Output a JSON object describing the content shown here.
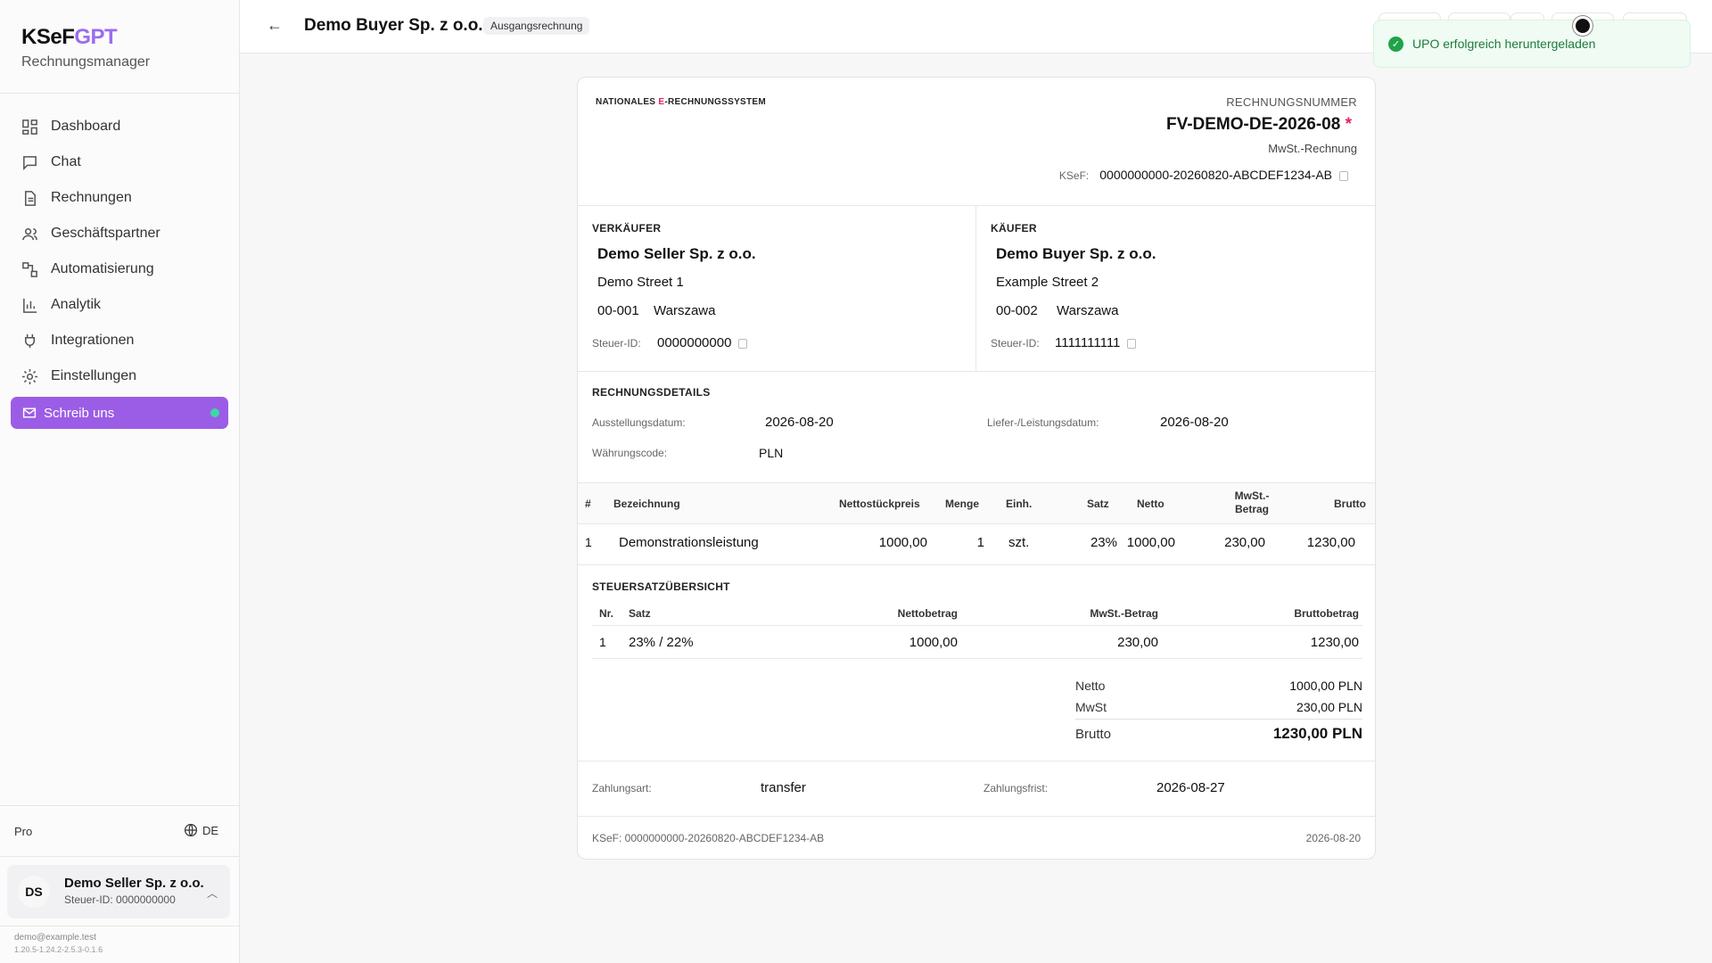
{
  "sidebar": {
    "brand_main": "KSeF",
    "brand_accent": "GPT",
    "brand_sub": "Rechnungsmanager",
    "nav": [
      {
        "label": "Dashboard",
        "icon": "dashboard-icon"
      },
      {
        "label": "Chat",
        "icon": "chat-icon"
      },
      {
        "label": "Rechnungen",
        "icon": "document-icon"
      },
      {
        "label": "Geschäftspartner",
        "icon": "users-icon"
      },
      {
        "label": "Automatisierung",
        "icon": "workflow-icon"
      },
      {
        "label": "Analytik",
        "icon": "bar-chart-icon"
      },
      {
        "label": "Integrationen",
        "icon": "plug-icon"
      },
      {
        "label": "Einstellungen",
        "icon": "gear-icon"
      }
    ],
    "write_us": "Schreib uns",
    "plan": "Pro",
    "language": "DE",
    "account": {
      "initials": "DS",
      "name": "Demo Seller Sp. z o.o.",
      "tax_id": "Steuer-ID: 0000000000"
    },
    "email": "demo@example.test",
    "version": "1.20.5-1.24.2-2.5.3-0.1.6"
  },
  "header": {
    "title": "Demo Buyer Sp. z o.o.",
    "badge": "Ausgangsrechnung"
  },
  "toast": {
    "message": "UPO erfolgreich heruntergeladen"
  },
  "invoice": {
    "system_name_pre": "NATIONALES ",
    "system_name_accent": "E",
    "system_name_post": "-RECHNUNGSSYSTEM",
    "number_label": "RECHNUNGSNUMMER",
    "number": "FV-DEMO-DE-2026-08",
    "required_mark": "*",
    "type": "MwSt.-Rechnung",
    "ksef_label": "KSeF:",
    "ksef_number": "0000000000-20260820-ABCDEF1234-AB",
    "seller": {
      "heading": "VERKÄUFER",
      "name": "Demo Seller Sp. z o.o.",
      "street": "Demo Street 1",
      "zip": "00-001",
      "city": "Warszawa",
      "tax_label": "Steuer-ID:",
      "tax_id": "0000000000"
    },
    "buyer": {
      "heading": "KÄUFER",
      "name": "Demo Buyer Sp. z o.o.",
      "street": "Example Street 2",
      "zip": "00-002",
      "city": "Warszawa",
      "tax_label": "Steuer-ID:",
      "tax_id": "1111111111"
    },
    "details": {
      "heading": "RECHNUNGSDETAILS",
      "issue_label": "Ausstellungsdatum:",
      "issue_date": "2026-08-20",
      "delivery_label": "Liefer-/Leistungsdatum:",
      "delivery_date": "2026-08-20",
      "currency_label": "Währungscode:",
      "currency": "PLN"
    },
    "items_header": {
      "num": "#",
      "desc": "Bezeichnung",
      "unit_price": "Nettostückpreis",
      "qty": "Menge",
      "unit": "Einh.",
      "rate": "Satz",
      "net": "Netto",
      "vat_line1": "MwSt.-",
      "vat_line2": "Betrag",
      "gross": "Brutto"
    },
    "items": [
      {
        "num": "1",
        "desc": "Demonstrationsleistung",
        "unit_price": "1000,00",
        "qty": "1",
        "unit": "szt.",
        "rate": "23%",
        "net": "1000,00",
        "vat": "230,00",
        "gross": "1230,00"
      }
    ],
    "tax_summary": {
      "heading": "STEUERSATZÜBERSICHT",
      "cols": {
        "nr": "Nr.",
        "rate": "Satz",
        "net": "Nettobetrag",
        "vat": "MwSt.-Betrag",
        "gross": "Bruttobetrag"
      },
      "rows": [
        {
          "nr": "1",
          "rate": "23% / 22%",
          "net": "1000,00",
          "vat": "230,00",
          "gross": "1230,00"
        }
      ]
    },
    "totals": {
      "net_label": "Netto",
      "net": "1000,00 PLN",
      "vat_label": "MwSt",
      "vat": "230,00 PLN",
      "gross_label": "Brutto",
      "gross": "1230,00 PLN"
    },
    "payment": {
      "method_label": "Zahlungsart:",
      "method": "transfer",
      "due_label": "Zahlungsfrist:",
      "due": "2026-08-27"
    },
    "footer": {
      "ksef": "KSeF: 0000000000-20260820-ABCDEF1234-AB",
      "date": "2026-08-20"
    }
  },
  "colors": {
    "accent": "#9b5de5",
    "success": "#1fa34a",
    "required": "#e0245e"
  }
}
